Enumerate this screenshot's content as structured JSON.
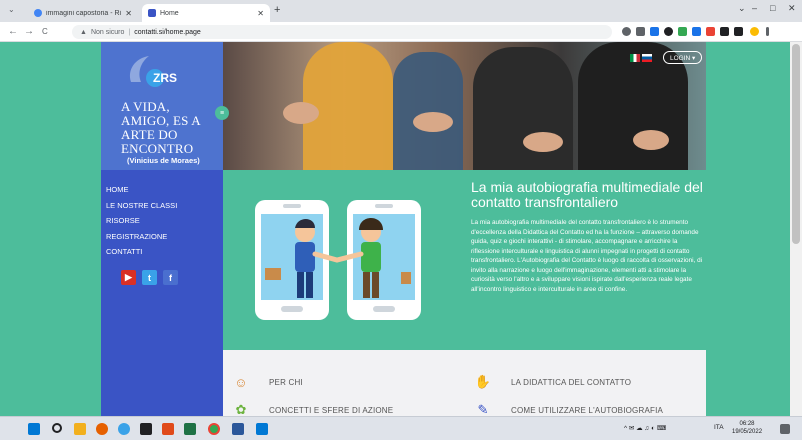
{
  "browser": {
    "tabs": [
      {
        "title": "immagini capostoria - Ricerca G",
        "favicon_color": "#4285f4"
      },
      {
        "title": "Home",
        "favicon_color": "#3a54c5"
      }
    ],
    "new_tab": "+",
    "window_controls": {
      "minimize": "–",
      "maximize": "□",
      "close": "✕",
      "tab_search": "⌄"
    },
    "nav": {
      "back": "←",
      "forward": "→",
      "reload": "C"
    },
    "address": {
      "security_icon": "warning-icon",
      "security_label": "Non sicuro",
      "separator": "|",
      "url": "contatti.si/home.page"
    },
    "extension_colors": [
      "#5f6368",
      "#5f6368",
      "#1a73e8",
      "#202124",
      "#34a853",
      "#1a73e8",
      "#ea4335",
      "#202124",
      "#202124",
      "#fbbc04",
      "#5f6368"
    ]
  },
  "sidebar": {
    "logo_text": "ZRS",
    "quote": "A VIDA, AMIGO, ES A ARTE DO ENCONTRO",
    "quote_author": "(Vinicius de Moraes)",
    "menu_toggle": "≡",
    "nav_items": [
      "HOME",
      "LE NOSTRE CLASSI",
      "RISORSE",
      "REGISTRAZIONE",
      "CONTATTI"
    ],
    "social": [
      {
        "name": "youtube",
        "label": "▶",
        "color": "#d93025"
      },
      {
        "name": "twitter",
        "label": "t",
        "color": "#3aa2e8"
      },
      {
        "name": "facebook",
        "label": "f",
        "color": "#4a6fcf"
      }
    ]
  },
  "header": {
    "login_label": "LOGIN ▾",
    "flags": [
      {
        "name": "italian-flag"
      },
      {
        "name": "slovenian-flag"
      }
    ]
  },
  "main": {
    "title": "La mia autobiografia multimediale del contatto transfrontaliero",
    "body": "La mia autobiografia multimediale del contatto transfrontaliero è lo strumento d'eccellenza della Didattica del Contatto ed ha la funzione – attraverso domande guida, quiz e giochi interattivi - di stimolare, accompagnare e arricchire la riflessione interculturale e linguistica di alunni impegnati in progetti di contatto transfrontaliero. L'Autobiografia del Contatto è luogo di raccolta di osservazioni, di invito alla narrazione e luogo dell'immaginazione, elementi atti a stimolare la curiosità verso l'altro e a sviluppare visioni ispirate dall'esperienza reale legate all'incontro linguistico e interculturale in aree di confine."
  },
  "features": [
    {
      "label": "PER CHI",
      "icon": "people-icon"
    },
    {
      "label": "LA DIDATTICA DEL CONTATTO",
      "icon": "handshake-icon"
    },
    {
      "label": "CONCETTI E SFERE DI AZIONE",
      "icon": "plant-icon"
    },
    {
      "label": "COME UTILIZZARE L'AUTOBIOGRAFIA",
      "icon": "edit-document-icon"
    }
  ],
  "taskbar": {
    "language": "ITA",
    "time": "06:28",
    "date": "19/05/2022",
    "app_colors": [
      "#0078d4",
      "#202124",
      "#f2b01e",
      "#e66000",
      "#3aa2e8",
      "#202124",
      "#e04a1a",
      "#1e7145",
      "#34a853",
      "#2b579a",
      "#0078d4"
    ]
  }
}
